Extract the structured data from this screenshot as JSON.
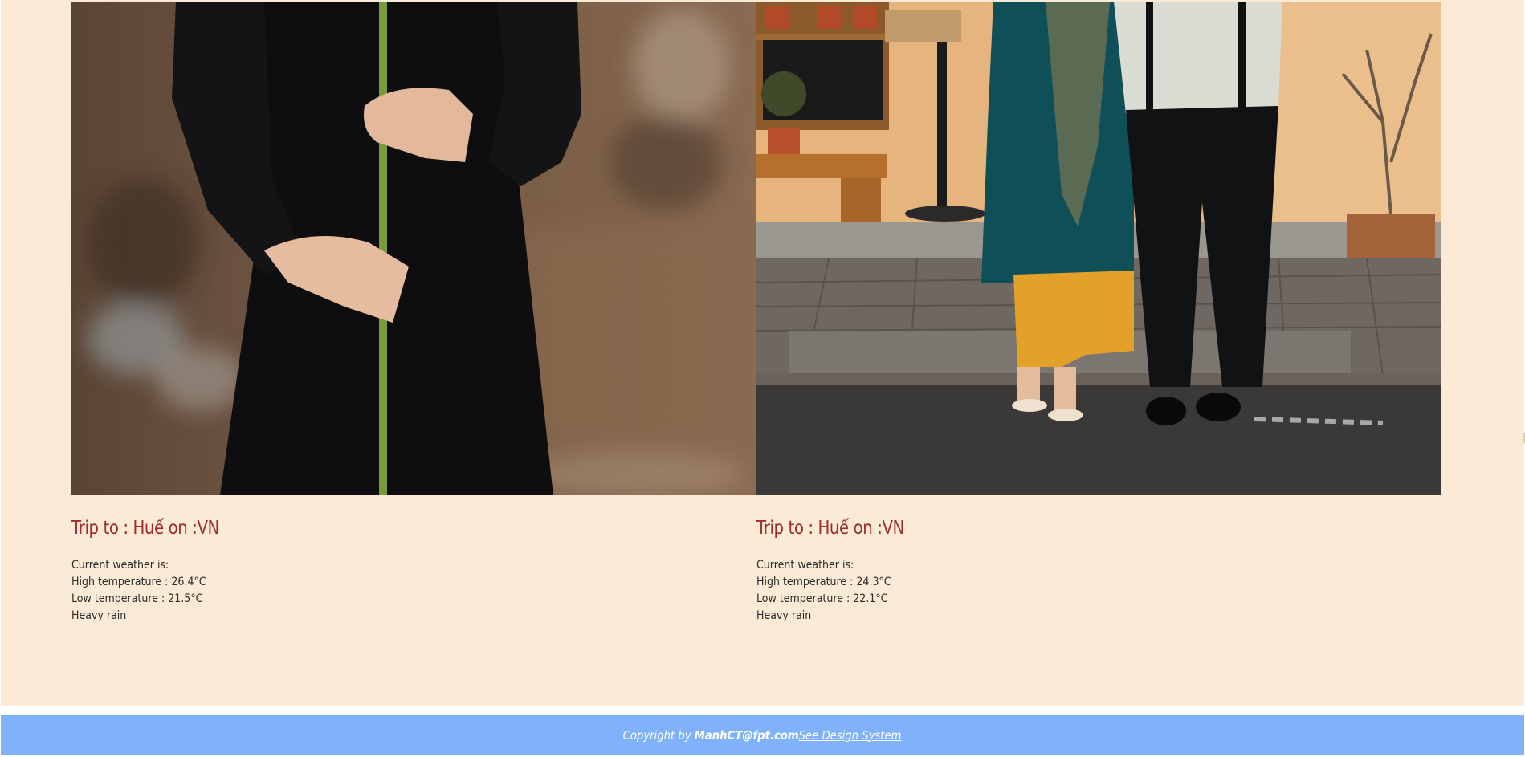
{
  "cards": [
    {
      "title": "Trip to : Huế on :VN",
      "weather_heading": "Current weather is:",
      "high": "High temperature : 26.4°C",
      "low": "Low temperature : 21.5°C",
      "condition": "Heavy rain"
    },
    {
      "title": "Trip to : Huế on :VN",
      "weather_heading": "Current weather is:",
      "high": "High temperature : 24.3°C",
      "low": "Low temperature : 22.1°C",
      "condition": "Heavy rain"
    }
  ],
  "footer": {
    "prefix": "Copyright by ",
    "email": "ManhCT@fpt.com",
    "link_label": "See Design System"
  },
  "colors": {
    "page_background": "#fbead5",
    "title": "#9f2b2b",
    "footer": "#80b2fc"
  }
}
